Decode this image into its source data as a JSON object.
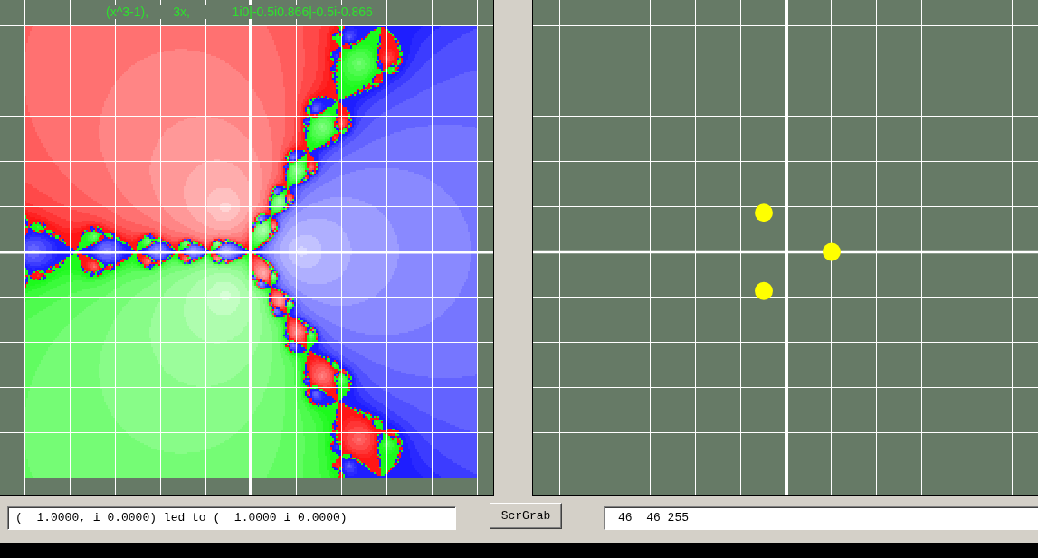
{
  "fractal_panel": {
    "formula": "(x^3-1),       3x,            1i0|-0.5i0.866|-0.5i-0.866"
  },
  "status_bar": {
    "result_field": "(  1.0000, i 0.0000) led to (  1.0000 i 0.0000)",
    "button": "ScrGrab",
    "color_field": "46  46 255"
  }
}
